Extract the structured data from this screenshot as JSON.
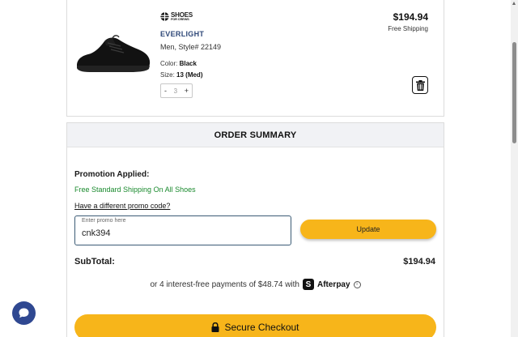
{
  "product": {
    "brand_top": "SHOES",
    "brand_bottom": "FOR CREWS",
    "name": "EVERLIGHT",
    "subtitle": "Men, Style# 22149",
    "color_label": "Color:",
    "color_value": "Black",
    "size_label": "Size:",
    "size_value": "13 (Med)",
    "qty_minus": "-",
    "qty_value": "3",
    "qty_plus": "+",
    "price": "$194.94",
    "shipping": "Free Shipping"
  },
  "summary": {
    "header": "ORDER SUMMARY",
    "promo_title": "Promotion Applied:",
    "promo_applied": "Free Standard Shipping On All Shoes",
    "promo_link": "Have a different promo code?",
    "promo_field_label": "Enter promo here",
    "promo_value": "cnk394",
    "update_label": "Update",
    "subtotal_label": "SubTotal:",
    "subtotal_value": "$194.94",
    "afterpay_text": "or 4 interest-free payments of $48.74 with",
    "afterpay_badge": "S",
    "afterpay_name": "Afterpay",
    "info_glyph": "i",
    "checkout_label": "Secure Checkout"
  },
  "colors": {
    "accent_yellow": "#f7b51a",
    "brand_blue": "#2f4878",
    "promo_green": "#1a8a2e",
    "chat_blue": "#2f4891"
  }
}
